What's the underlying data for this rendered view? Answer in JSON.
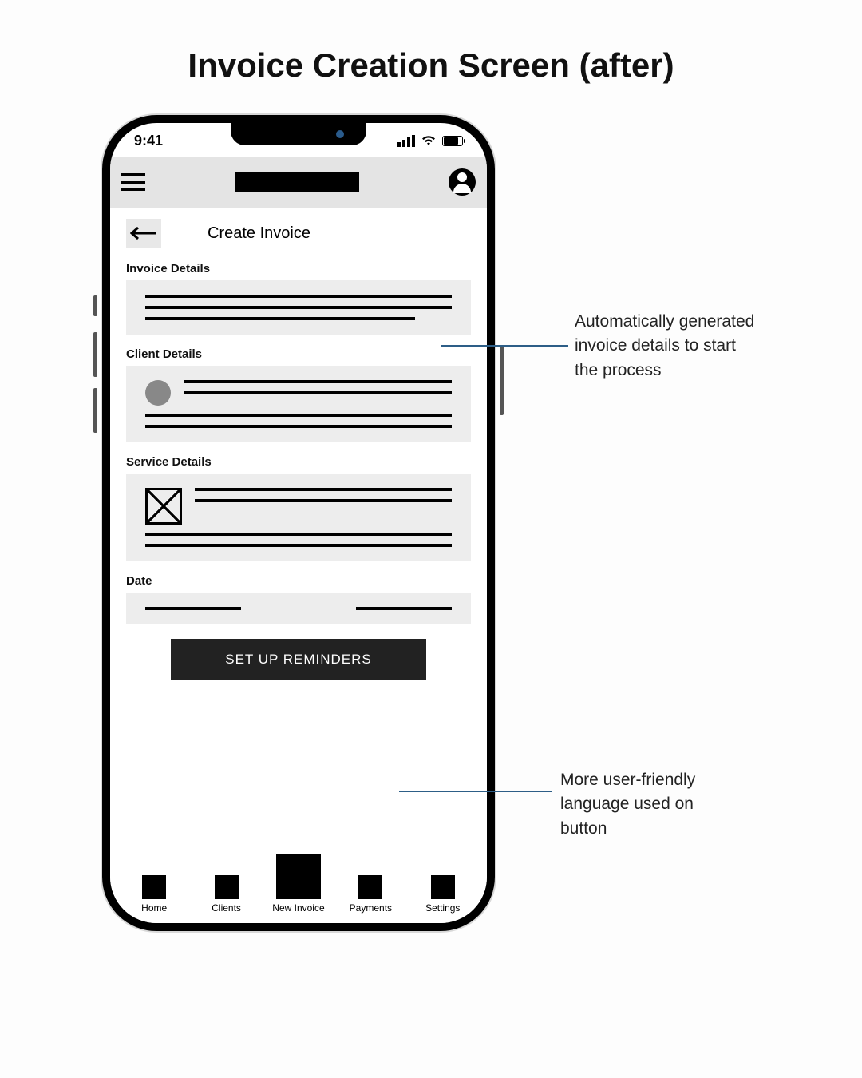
{
  "page_title": "Invoice Creation Screen (after)",
  "status": {
    "time": "9:41"
  },
  "screen": {
    "title": "Create Invoice",
    "sections": {
      "invoice": "Invoice Details",
      "client": "Client Details",
      "service": "Service Details",
      "date": "Date"
    },
    "cta": "SET UP REMINDERS"
  },
  "nav": {
    "items": [
      {
        "label": "Home"
      },
      {
        "label": "Clients"
      },
      {
        "label": "New Invoice"
      },
      {
        "label": "Payments"
      },
      {
        "label": "Settings"
      }
    ]
  },
  "annotations": {
    "a1": "Automatically generated invoice details to start the process",
    "a2": "More user-friendly language used on button"
  }
}
